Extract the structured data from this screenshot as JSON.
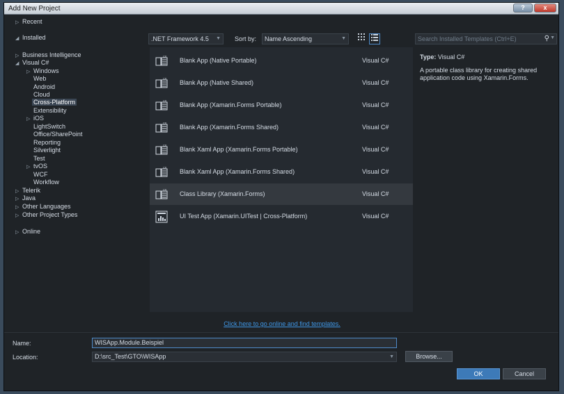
{
  "window": {
    "title": "Add New Project",
    "help_label": "?",
    "close_label": "x"
  },
  "tree": [
    {
      "label": "Recent",
      "arrow": "▷"
    },
    {
      "label": "Installed",
      "arrow": "◢"
    },
    {
      "label": "Business Intelligence",
      "arrow": "▷"
    },
    {
      "label": "Visual C#",
      "arrow": "◢"
    },
    {
      "label": "Windows",
      "arrow": "▷"
    },
    {
      "label": "Web",
      "arrow": ""
    },
    {
      "label": "Android",
      "arrow": ""
    },
    {
      "label": "Cloud",
      "arrow": ""
    },
    {
      "label": "Cross-Platform",
      "arrow": ""
    },
    {
      "label": "Extensibility",
      "arrow": ""
    },
    {
      "label": "iOS",
      "arrow": "▷"
    },
    {
      "label": "LightSwitch",
      "arrow": ""
    },
    {
      "label": "Office/SharePoint",
      "arrow": ""
    },
    {
      "label": "Reporting",
      "arrow": ""
    },
    {
      "label": "Silverlight",
      "arrow": ""
    },
    {
      "label": "Test",
      "arrow": ""
    },
    {
      "label": "tvOS",
      "arrow": "▷"
    },
    {
      "label": "WCF",
      "arrow": ""
    },
    {
      "label": "Workflow",
      "arrow": ""
    },
    {
      "label": "Telerik",
      "arrow": "▷"
    },
    {
      "label": "Java",
      "arrow": "▷"
    },
    {
      "label": "Other Languages",
      "arrow": "▷"
    },
    {
      "label": "Other Project Types",
      "arrow": "▷"
    },
    {
      "label": "Online",
      "arrow": "▷"
    }
  ],
  "toolbar": {
    "framework": ".NET Framework 4.5",
    "sort_label": "Sort by:",
    "sort_value": "Name Ascending",
    "grid_view_icon": "grid-view-icon",
    "list_view_icon": "list-view-icon"
  },
  "templates": [
    {
      "name": "Blank App (Native Portable)",
      "lang": "Visual C#",
      "icon": "csharp-template-icon"
    },
    {
      "name": "Blank App (Native Shared)",
      "lang": "Visual C#",
      "icon": "csharp-template-icon"
    },
    {
      "name": "Blank App (Xamarin.Forms Portable)",
      "lang": "Visual C#",
      "icon": "csharp-template-icon"
    },
    {
      "name": "Blank App (Xamarin.Forms Shared)",
      "lang": "Visual C#",
      "icon": "csharp-template-icon"
    },
    {
      "name": "Blank Xaml App (Xamarin.Forms Portable)",
      "lang": "Visual C#",
      "icon": "csharp-template-icon"
    },
    {
      "name": "Blank Xaml App (Xamarin.Forms Shared)",
      "lang": "Visual C#",
      "icon": "csharp-template-icon"
    },
    {
      "name": "Class Library (Xamarin.Forms)",
      "lang": "Visual C#",
      "icon": "csharp-template-icon"
    },
    {
      "name": "UI Test App (Xamarin.UITest | Cross-Platform)",
      "lang": "Visual C#",
      "icon": "uitest-template-icon"
    }
  ],
  "search": {
    "placeholder": "Search Installed Templates (Ctrl+E)"
  },
  "info": {
    "type_key": "Type:",
    "type_value": "Visual C#",
    "description": "A portable class library for creating shared application code using Xamarin.Forms."
  },
  "online_link": "Click here to go online and find templates.",
  "form": {
    "name_label": "Name:",
    "name_value": "WISApp.Module.Beispiel",
    "location_label": "Location:",
    "location_value": "D:\\src_Test\\GTO\\WISApp",
    "browse_label": "Browse...",
    "ok_label": "OK",
    "cancel_label": "Cancel"
  }
}
